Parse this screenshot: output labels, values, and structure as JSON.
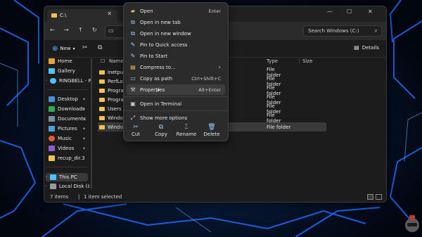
{
  "window": {
    "tab_title": "C:\\",
    "search_placeholder": "Search Windows (C:)",
    "new_label": "New",
    "details_label": "Details"
  },
  "sidebar": {
    "items": [
      {
        "label": "Home",
        "icon": "home-icon",
        "color": "#e8a33b"
      },
      {
        "label": "Gallery",
        "icon": "gallery-icon",
        "color": "#4cc2ff"
      },
      {
        "label": "RINGBELL - P",
        "icon": "cloud-icon",
        "color": "#4cc2ff"
      },
      {
        "label": "Desktop",
        "icon": "desktop-icon",
        "color": "#4a90d9"
      },
      {
        "label": "Downloads",
        "icon": "download-icon",
        "color": "#35a853"
      },
      {
        "label": "Documents",
        "icon": "document-icon",
        "color": "#7a8fa6"
      },
      {
        "label": "Pictures",
        "icon": "picture-icon",
        "color": "#4aa3df"
      },
      {
        "label": "Music",
        "icon": "music-icon",
        "color": "#e05b3a"
      },
      {
        "label": "Videos",
        "icon": "video-icon",
        "color": "#8e5bd6"
      },
      {
        "label": "recup_dir.3",
        "icon": "folder-icon",
        "color": "#f2c14e"
      },
      {
        "label": "This PC",
        "icon": "pc-icon",
        "color": "#4cc2ff"
      },
      {
        "label": "Local Disk (I:",
        "icon": "disk-icon",
        "color": "#9a9a9a"
      }
    ]
  },
  "columns": {
    "name": "Name",
    "type": "Type",
    "size": "Size"
  },
  "files": [
    {
      "name": "inetpub",
      "type": "File folder"
    },
    {
      "name": "PerfLogs",
      "type": "File folder"
    },
    {
      "name": "Program Files",
      "type": "File folder"
    },
    {
      "name": "Program Files (x86)",
      "type": "File folder"
    },
    {
      "name": "Users",
      "type": "File folder"
    },
    {
      "name": "Windows",
      "type": "File folder"
    },
    {
      "name": "Windows.old",
      "type": "File folder",
      "selected": true
    }
  ],
  "status": {
    "items": "7 items",
    "selected": "1 item selected"
  },
  "context_menu": {
    "items": [
      {
        "label": "Open",
        "shortcut": "Enter",
        "icon": "folder-open-icon"
      },
      {
        "label": "Open in new tab",
        "shortcut": "",
        "icon": "new-tab-icon"
      },
      {
        "label": "Open in new window",
        "shortcut": "",
        "icon": "new-window-icon"
      },
      {
        "label": "Pin to Quick access",
        "shortcut": "",
        "icon": "pin-icon"
      },
      {
        "label": "Pin to Start",
        "shortcut": "",
        "icon": "pin-icon"
      },
      {
        "label": "Compress to...",
        "shortcut": "",
        "icon": "zip-icon",
        "submenu": true
      },
      {
        "label": "Copy as path",
        "shortcut": "Ctrl+Shift+C",
        "icon": "path-icon"
      },
      {
        "label": "Properties",
        "shortcut": "Alt+Enter",
        "icon": "wrench-icon",
        "highlighted": true
      },
      {
        "label": "Open in Terminal",
        "shortcut": "",
        "icon": "terminal-icon"
      },
      {
        "label": "Show more options",
        "shortcut": "",
        "icon": "more-options-icon"
      }
    ],
    "quick_actions": [
      {
        "label": "Cut",
        "icon": "cut-icon"
      },
      {
        "label": "Copy",
        "icon": "copy-icon"
      },
      {
        "label": "Rename",
        "icon": "rename-icon"
      },
      {
        "label": "Delete",
        "icon": "delete-icon"
      }
    ]
  }
}
